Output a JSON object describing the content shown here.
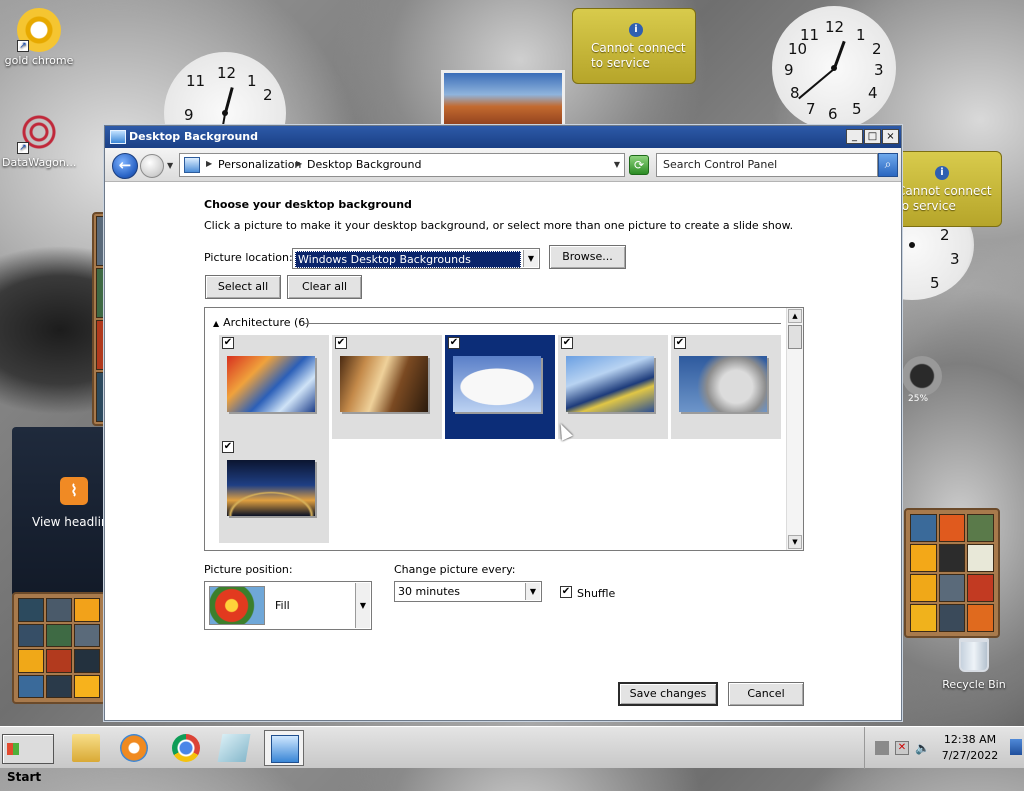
{
  "desktop": {
    "icons": [
      {
        "label": "gold chrome"
      },
      {
        "label": "DataWagon..."
      }
    ],
    "weather_gadgets": [
      {
        "message": "Cannot connect to service"
      },
      {
        "message": "Cannot connect to service"
      }
    ],
    "rss_gadget": {
      "label": "View headlin"
    },
    "gauge_value": "25%",
    "recycle_bin": {
      "label": "Recycle Bin"
    }
  },
  "window": {
    "title": "Desktop Background",
    "controls": {
      "minimize": "_",
      "maximize": "□",
      "close": "×"
    },
    "breadcrumb": [
      "Personalization",
      "Desktop Background"
    ],
    "search": {
      "placeholder": "Search Control Panel"
    },
    "heading": "Choose your desktop background",
    "subtext": "Click a picture to make it your desktop background, or select more than one picture to create a slide show.",
    "picture_location": {
      "label": "Picture location:",
      "value": "Windows Desktop Backgrounds",
      "browse_label": "Browse..."
    },
    "select_all_label": "Select all",
    "clear_all_label": "Clear all",
    "gallery": {
      "group_title": "Architecture (6)",
      "items": [
        {
          "checked": true,
          "selected": false,
          "image": "img1"
        },
        {
          "checked": true,
          "selected": false,
          "image": "img2"
        },
        {
          "checked": true,
          "selected": true,
          "image": "img3"
        },
        {
          "checked": true,
          "selected": false,
          "image": "img4"
        },
        {
          "checked": true,
          "selected": false,
          "image": "img5"
        },
        {
          "checked": true,
          "selected": false,
          "image": "img6"
        }
      ]
    },
    "picture_position": {
      "label": "Picture position:",
      "value": "Fill"
    },
    "change_picture": {
      "label": "Change picture every:",
      "value": "30 minutes"
    },
    "shuffle": {
      "label": "Shuffle",
      "checked": true
    },
    "save_label": "Save changes",
    "cancel_label": "Cancel"
  },
  "taskbar": {
    "start_label": "Start",
    "apps": [
      "folder-icon",
      "media-player-icon",
      "chrome-icon",
      "notepad-icon",
      "control-panel-icon"
    ],
    "time": "12:38 AM",
    "date": "7/27/2022"
  }
}
